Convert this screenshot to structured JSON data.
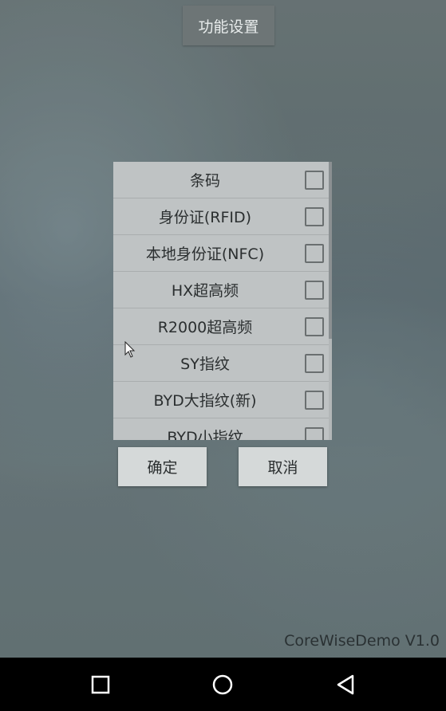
{
  "top_button": {
    "label": "功能设置"
  },
  "dialog": {
    "items": [
      {
        "label": "条码",
        "checked": false
      },
      {
        "label": "身份证(RFID)",
        "checked": false
      },
      {
        "label": "本地身份证(NFC)",
        "checked": false
      },
      {
        "label": "HX超高频",
        "checked": false
      },
      {
        "label": "R2000超高频",
        "checked": false
      },
      {
        "label": "SY指纹",
        "checked": false
      },
      {
        "label": "BYD大指纹(新)",
        "checked": false
      },
      {
        "label": "BYD小指纹",
        "checked": false
      }
    ],
    "ok_label": "确定",
    "cancel_label": "取消"
  },
  "footer": {
    "version": "CoreWiseDemo V1.0"
  },
  "navbar": {
    "buttons": [
      "square-icon",
      "circle-icon",
      "triangle-back-icon"
    ]
  }
}
